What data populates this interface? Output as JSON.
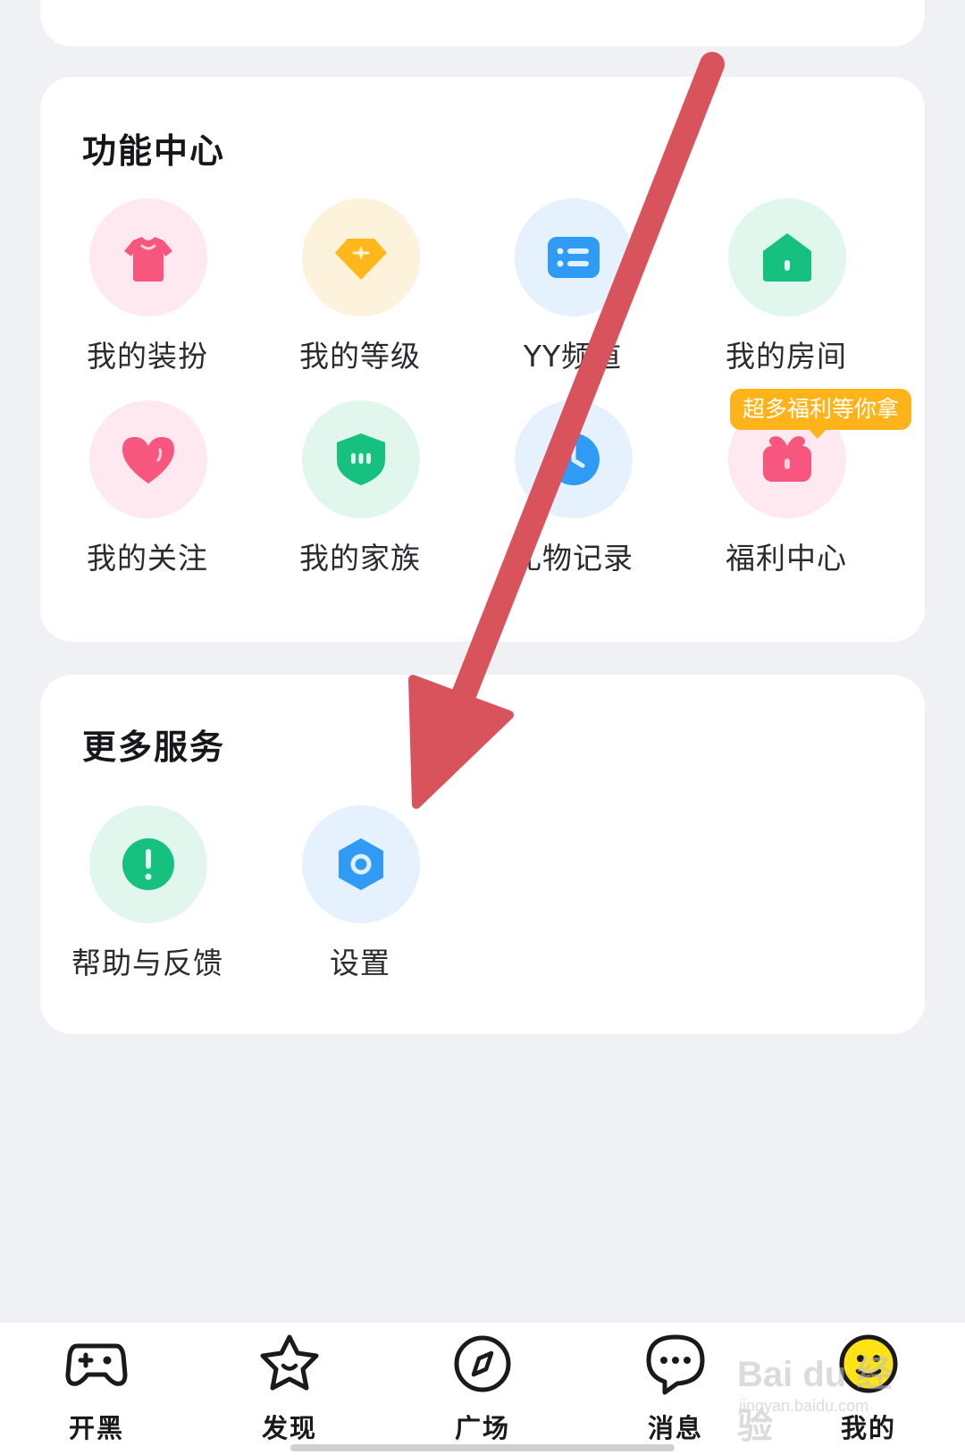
{
  "function_center": {
    "title": "功能中心",
    "items": [
      {
        "label": "我的装扮",
        "icon": "clothes-icon",
        "bg": "#fde9ef"
      },
      {
        "label": "我的等级",
        "icon": "diamond-icon",
        "bg": "#fdf3dc"
      },
      {
        "label": "YY频道",
        "icon": "channel-list-icon",
        "bg": "#e5f2fd"
      },
      {
        "label": "我的房间",
        "icon": "house-icon",
        "bg": "#e1f7ee"
      },
      {
        "label": "我的关注",
        "icon": "heart-icon",
        "bg": "#fde9ef"
      },
      {
        "label": "我的家族",
        "icon": "family-shield-icon",
        "bg": "#e1f7ee"
      },
      {
        "label": "礼物记录",
        "icon": "clock-icon",
        "bg": "#e5f2fd"
      },
      {
        "label": "福利中心",
        "icon": "gift-icon",
        "bg": "#fde9ef"
      }
    ],
    "badge": "超多福利等你拿"
  },
  "more_services": {
    "title": "更多服务",
    "items": [
      {
        "label": "帮助与反馈",
        "icon": "help-icon",
        "bg": "#e1f7ee"
      },
      {
        "label": "设置",
        "icon": "settings-icon",
        "bg": "#e5f2fd"
      }
    ]
  },
  "tabbar": {
    "items": [
      {
        "label": "开黑",
        "icon": "gamepad-icon"
      },
      {
        "label": "发现",
        "icon": "star-icon"
      },
      {
        "label": "广场",
        "icon": "compass-icon"
      },
      {
        "label": "消息",
        "icon": "chat-bubble-icon"
      },
      {
        "label": "我的",
        "icon": "smiley-avatar-icon",
        "active": true
      }
    ]
  },
  "watermark": {
    "brand": "Bai du 经验",
    "sub": "jingyan.baidu.com"
  },
  "colors": {
    "background": "#f0f1f5",
    "card": "#ffffff",
    "badge": "#ffb31a",
    "annotation_arrow": "#d9535c",
    "pink_icon": "#f7567e",
    "gold_icon": "#ffb81c",
    "blue_icon": "#2f9bf5",
    "green_icon": "#16c07f",
    "active_tab": "#ffe316"
  }
}
